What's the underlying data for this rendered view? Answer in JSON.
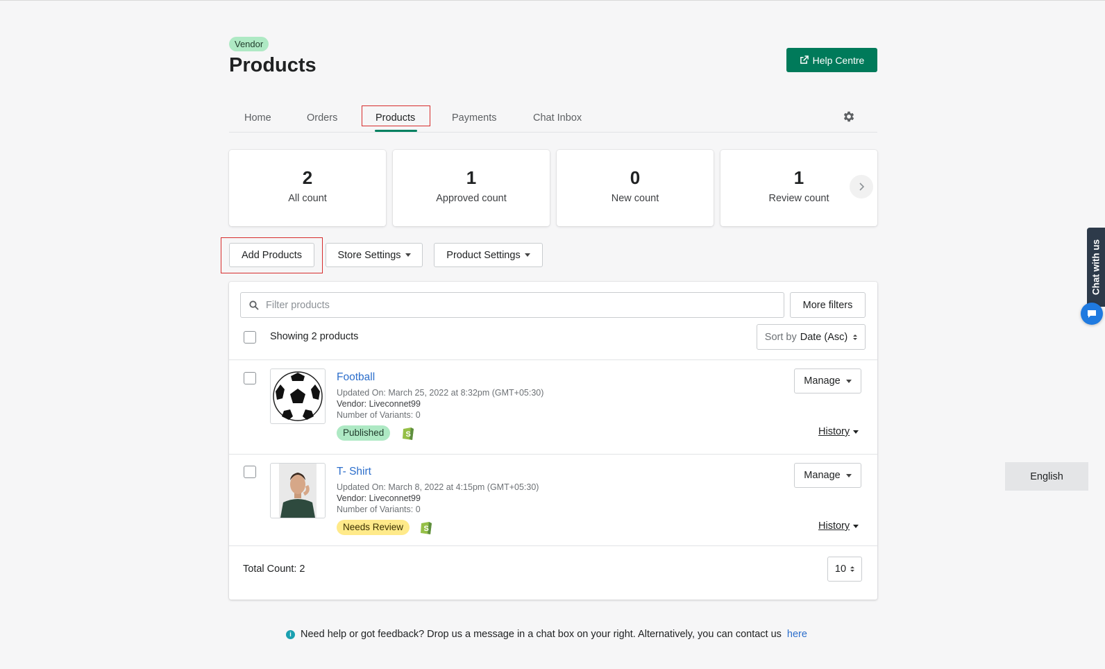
{
  "header": {
    "badge": "Vendor",
    "title": "Products",
    "help_label": "Help Centre"
  },
  "tabs": [
    {
      "label": "Home"
    },
    {
      "label": "Orders"
    },
    {
      "label": "Products",
      "active": true
    },
    {
      "label": "Payments"
    },
    {
      "label": "Chat Inbox"
    }
  ],
  "stats": [
    {
      "value": "2",
      "label": "All count"
    },
    {
      "value": "1",
      "label": "Approved count"
    },
    {
      "value": "0",
      "label": "New count"
    },
    {
      "value": "1",
      "label": "Review count"
    }
  ],
  "actions": {
    "add_products": "Add Products",
    "store_settings": "Store Settings",
    "product_settings": "Product Settings"
  },
  "list": {
    "search_placeholder": "Filter products",
    "more_filters": "More filters",
    "showing": "Showing 2 products",
    "sort_prefix": "Sort by",
    "sort_value": "Date (Asc)",
    "products": [
      {
        "name": "Football",
        "updated": "Updated On: March 25, 2022 at 8:32pm (GMT+05:30)",
        "vendor": "Vendor: Liveconnet99",
        "variants": "Number of Variants: 0",
        "status": "Published",
        "manage": "Manage",
        "history": "History",
        "image_icon": "soccer-ball"
      },
      {
        "name": "T- Shirt",
        "updated": "Updated On: March 8, 2022 at 4:15pm (GMT+05:30)",
        "vendor": "Vendor: Liveconnet99",
        "variants": "Number of Variants: 0",
        "status": "Needs Review",
        "manage": "Manage",
        "history": "History",
        "image_icon": "man-in-tshirt-photo"
      }
    ],
    "total": "Total Count: 2",
    "per_page": "10"
  },
  "footer": {
    "feedback": "Need help or got feedback? Drop us a message in a chat box on your right. Alternatively, you can contact us",
    "link": "here"
  },
  "widgets": {
    "chat_tab": "Chat with us",
    "language": "English"
  },
  "colors": {
    "accent": "#007a5a",
    "highlight_outline": "#d72c2c",
    "published": "#aee9c4",
    "needs_review": "#ffea8a",
    "link": "#2c6ecb"
  }
}
